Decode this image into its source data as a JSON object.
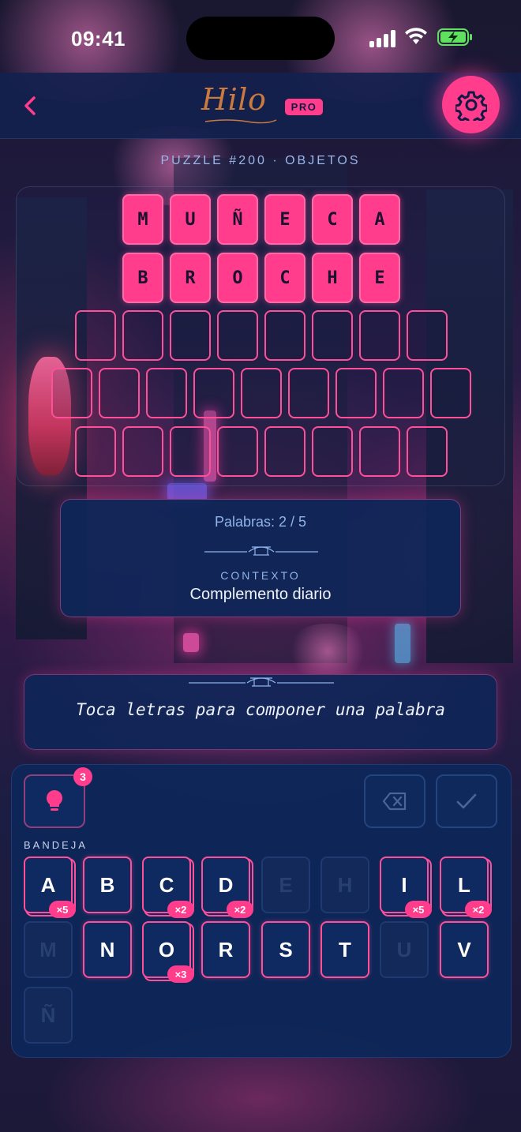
{
  "status_bar": {
    "time": "09:41"
  },
  "header": {
    "brand": "Hilo",
    "badge": "PRO"
  },
  "puzzle": {
    "subtitle": "PUZZLE #200 · OBJETOS"
  },
  "board": {
    "rows": [
      {
        "letters": [
          "M",
          "U",
          "Ñ",
          "E",
          "C",
          "A"
        ],
        "solved": true
      },
      {
        "letters": [
          "B",
          "R",
          "O",
          "C",
          "H",
          "E"
        ],
        "solved": true
      },
      {
        "length": 8,
        "solved": false
      },
      {
        "length": 9,
        "solved": false
      },
      {
        "length": 8,
        "solved": false
      }
    ]
  },
  "info": {
    "progress": "Palabras: 2 / 5",
    "context_label": "CONTEXTO",
    "context_value": "Complemento diario"
  },
  "hint_banner": {
    "text": "Toca letras para componer una palabra"
  },
  "controls": {
    "hints_remaining": "3",
    "tray_label": "BANDEJA"
  },
  "tray": [
    {
      "letter": "A",
      "count": "×5",
      "active": true
    },
    {
      "letter": "B",
      "count": "",
      "active": true
    },
    {
      "letter": "C",
      "count": "×2",
      "active": true
    },
    {
      "letter": "D",
      "count": "×2",
      "active": true
    },
    {
      "letter": "E",
      "count": "",
      "active": false
    },
    {
      "letter": "H",
      "count": "",
      "active": false
    },
    {
      "letter": "I",
      "count": "×5",
      "active": true
    },
    {
      "letter": "L",
      "count": "×2",
      "active": true
    },
    {
      "letter": "M",
      "count": "",
      "active": false
    },
    {
      "letter": "N",
      "count": "",
      "active": true
    },
    {
      "letter": "O",
      "count": "×3",
      "active": true
    },
    {
      "letter": "R",
      "count": "",
      "active": true
    },
    {
      "letter": "S",
      "count": "",
      "active": true
    },
    {
      "letter": "T",
      "count": "",
      "active": true
    },
    {
      "letter": "U",
      "count": "",
      "active": false
    },
    {
      "letter": "V",
      "count": "",
      "active": true
    },
    {
      "letter": "Ñ",
      "count": "",
      "active": false
    }
  ],
  "colors": {
    "accent": "#ff3d8c",
    "panel": "#0e2658",
    "muted_text": "#8fb4ea"
  },
  "icons": [
    "back-chevron-icon",
    "gear-icon",
    "lightbulb-icon",
    "backspace-icon",
    "check-icon",
    "signal-icon",
    "wifi-icon",
    "battery-icon"
  ]
}
